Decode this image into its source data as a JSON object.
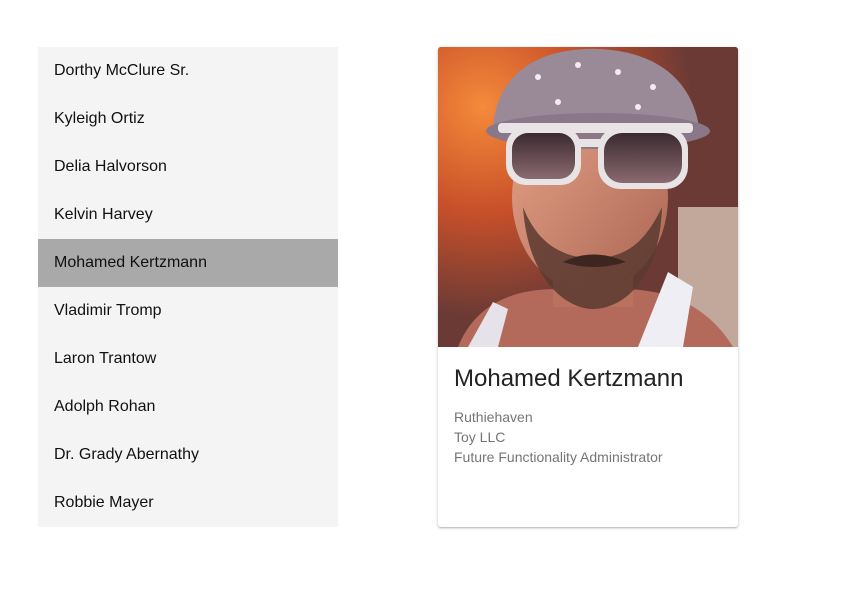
{
  "people_list": {
    "items": [
      {
        "name": "Dorthy McClure Sr.",
        "selected": false
      },
      {
        "name": "Kyleigh Ortiz",
        "selected": false
      },
      {
        "name": "Delia Halvorson",
        "selected": false
      },
      {
        "name": "Kelvin Harvey",
        "selected": false
      },
      {
        "name": "Mohamed Kertzmann",
        "selected": true
      },
      {
        "name": "Vladimir Tromp",
        "selected": false
      },
      {
        "name": "Laron Trantow",
        "selected": false
      },
      {
        "name": "Adolph Rohan",
        "selected": false
      },
      {
        "name": "Dr. Grady Abernathy",
        "selected": false
      },
      {
        "name": "Robbie Mayer",
        "selected": false
      }
    ]
  },
  "detail_card": {
    "name": "Mohamed Kertzmann",
    "city": "Ruthiehaven",
    "company": "Toy LLC",
    "title": "Future Functionality Administrator",
    "photo_icon": "person-photo"
  },
  "colors": {
    "list_background": "#f4f4f4",
    "selected_background": "#a9a9a9",
    "secondary_text": "#757575"
  }
}
